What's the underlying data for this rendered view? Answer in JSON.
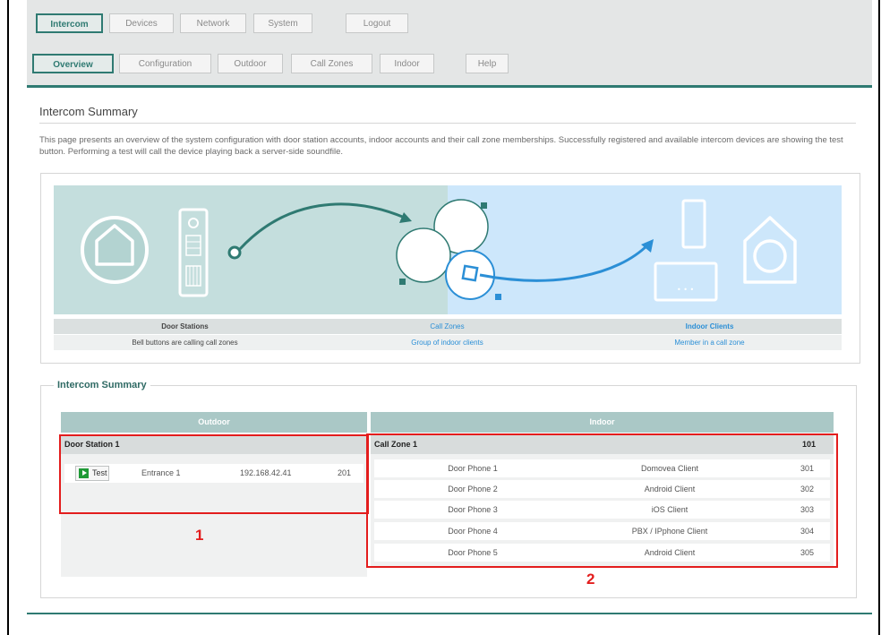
{
  "nav": {
    "main_tabs": [
      "Intercom",
      "Devices",
      "Network",
      "System"
    ],
    "logout": "Logout",
    "sub_tabs": [
      "Overview",
      "Configuration",
      "Outdoor",
      "Call Zones",
      "Indoor"
    ],
    "help": "Help"
  },
  "page": {
    "title": "Intercom Summary",
    "description": "This page presents an overview of the system configuration with door station accounts, indoor accounts and their call zone memberships. Successfully registered and available intercom devices are showing the test button. Performing a test will call the device playing back a server-side soundfile."
  },
  "diagram": {
    "captions": [
      {
        "title": "Door Stations",
        "sub": "Bell buttons are calling call zones"
      },
      {
        "title": "Call Zones",
        "sub": "Group of indoor clients"
      },
      {
        "title": "Indoor Clients",
        "sub": "Member in a call zone"
      }
    ],
    "colors": {
      "left_bg": "#c4dedd",
      "right_bg": "#cde7fb",
      "teal": "#2f7a72",
      "blue": "#2b8fd6"
    }
  },
  "summary": {
    "legend": "Intercom Summary",
    "outdoor_header": "Outdoor",
    "indoor_header": "Indoor",
    "door_station": {
      "name": "Door Station 1",
      "test_label": "Test",
      "location": "Entrance 1",
      "ip": "192.168.42.41",
      "ext": "201"
    },
    "call_zone": {
      "name": "Call Zone 1",
      "ext": "101",
      "rows": [
        {
          "name": "Door Phone 1",
          "client": "Domovea Client",
          "ext": "301"
        },
        {
          "name": "Door Phone 2",
          "client": "Android Client",
          "ext": "302"
        },
        {
          "name": "Door Phone 3",
          "client": "iOS Client",
          "ext": "303"
        },
        {
          "name": "Door Phone 4",
          "client": "PBX / IPphone Client",
          "ext": "304"
        },
        {
          "name": "Door Phone 5",
          "client": "Android Client",
          "ext": "305"
        }
      ]
    }
  },
  "annotations": {
    "label_1": "1",
    "label_2": "2",
    "color": "#e31d1d"
  }
}
